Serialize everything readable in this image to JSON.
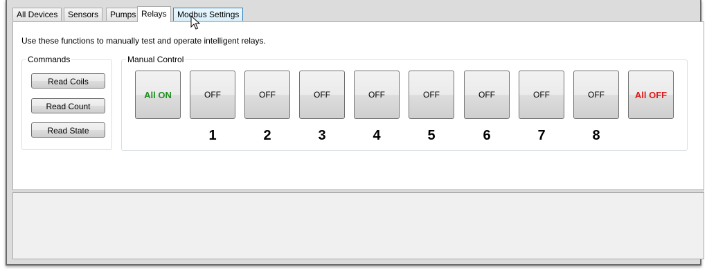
{
  "tabs": [
    {
      "label": "All Devices"
    },
    {
      "label": "Sensors"
    },
    {
      "label": "Pumps"
    },
    {
      "label": "Relays"
    },
    {
      "label": "Modbus Settings"
    }
  ],
  "active_tab": "Relays",
  "description": "Use these functions to manually test and operate intelligent relays.",
  "commands": {
    "title": "Commands",
    "buttons": [
      "Read Coils",
      "Read Count",
      "Read State"
    ]
  },
  "manual_control": {
    "title": "Manual Control",
    "all_on_label": "All ON",
    "all_off_label": "All OFF",
    "relays": [
      {
        "number": "1",
        "state": "OFF"
      },
      {
        "number": "2",
        "state": "OFF"
      },
      {
        "number": "3",
        "state": "OFF"
      },
      {
        "number": "4",
        "state": "OFF"
      },
      {
        "number": "5",
        "state": "OFF"
      },
      {
        "number": "6",
        "state": "OFF"
      },
      {
        "number": "7",
        "state": "OFF"
      },
      {
        "number": "8",
        "state": "OFF"
      }
    ],
    "colors": {
      "all_on": "#1f8f1f",
      "all_off": "#e01919"
    }
  },
  "icons": {
    "cursor": "mouse-pointer-icon"
  }
}
